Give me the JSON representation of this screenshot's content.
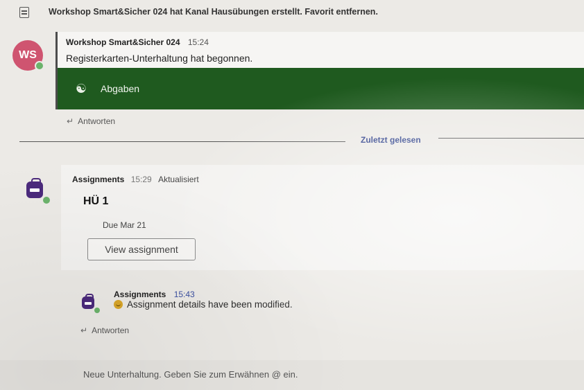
{
  "system_line": {
    "prefix": "Workshop Smart&Sicher 024 hat Kanal ",
    "channel": "Hausübungen",
    "suffix": " erstellt. ",
    "action": "Favorit entfernen."
  },
  "post": {
    "avatar_initials": "WS",
    "author": "Workshop Smart&Sicher 024",
    "time": "15:24",
    "body": "Registerkarten-Unterhaltung hat begonnen.",
    "tab_label": "Abgaben",
    "reply_label": "Antworten"
  },
  "divider": {
    "label": "Zuletzt gelesen"
  },
  "assignment_card": {
    "author": "Assignments",
    "time": "15:29",
    "tag": "Aktualisiert",
    "title": "HÜ 1",
    "due": "Due Mar 21",
    "button_label": "View assignment"
  },
  "update": {
    "author": "Assignments",
    "time": "15:43",
    "body": "Assignment details have been modified.",
    "reply_label": "Antworten"
  },
  "compose": {
    "placeholder": "Neue Unterhaltung. Geben Sie zum Erwähnen @ ein."
  },
  "colors": {
    "green_bar": "#1f5a1f",
    "avatar_ws": "#cf5470",
    "assignments_purple": "#4b2a7c",
    "last_read_blue": "#2c3f8a"
  }
}
